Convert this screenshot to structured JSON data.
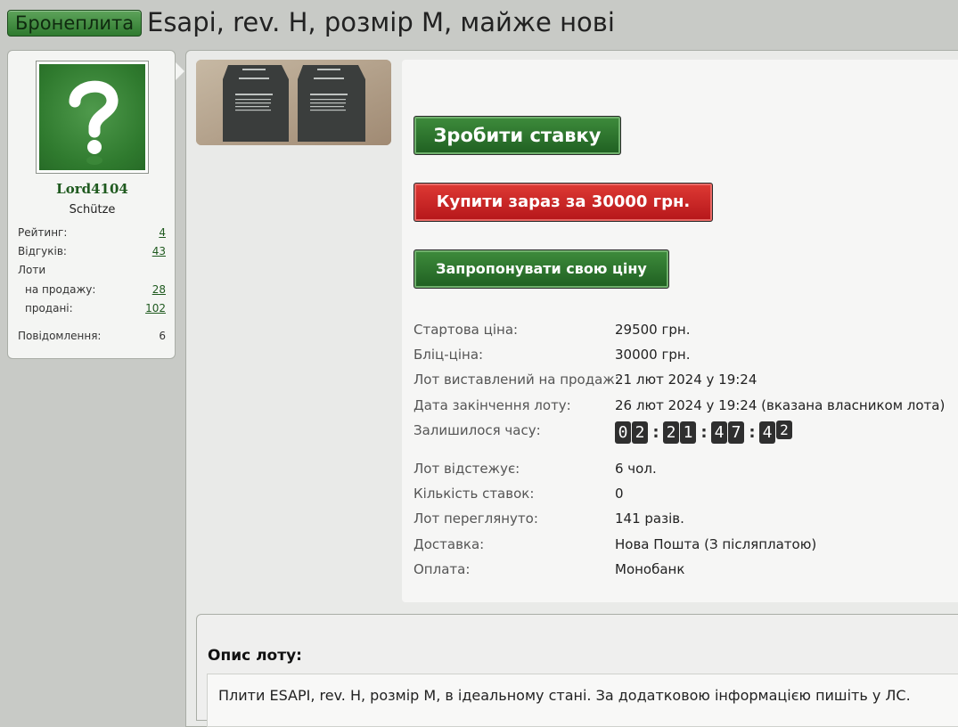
{
  "header": {
    "category_label": "Бронеплита",
    "title": "Esapi, rev. H, розмір M, майже нові"
  },
  "seller": {
    "username": "Lord4104",
    "rank": "Schütze",
    "stats": {
      "rating_label": "Рейтинг:",
      "rating_value": "4",
      "reviews_label": "Відгуків:",
      "reviews_value": "43",
      "lots_label": "Лоти",
      "on_sale_label": "на продажу:",
      "on_sale_value": "28",
      "sold_label": "продані:",
      "sold_value": "102",
      "messages_label": "Повідомлення:",
      "messages_value": "6"
    }
  },
  "actions": {
    "bid_label": "Зробити ставку",
    "buy_now_label": "Купити зараз за 30000 грн.",
    "offer_label": "Запропонувати свою ціну"
  },
  "details": {
    "start_price_label": "Стартова ціна:",
    "start_price_value": "29500 грн.",
    "blitz_price_label": "Бліц-ціна:",
    "blitz_price_value": "30000 грн.",
    "listed_label": "Лот виставлений на продаж:",
    "listed_value": "21 лют 2024 у 19:24",
    "end_label": "Дата закінчення лоту:",
    "end_value": "26 лют 2024 у 19:24 (вказана власником лота)",
    "remaining_label": "Залишилося часу:",
    "remaining_digits": [
      "0",
      "2",
      "2",
      "1",
      "4",
      "7",
      "4",
      "2"
    ],
    "remaining_separator": ":",
    "watchers_label": "Лот відстежує:",
    "watchers_value": "6 чол.",
    "bids_label": "Кількість ставок:",
    "bids_value": "0",
    "views_label": "Лот переглянуто:",
    "views_value": "141 разів.",
    "delivery_label": "Доставка:",
    "delivery_value": "Нова Пошта (З післяплатою)",
    "payment_label": "Оплата:",
    "payment_value": "Монобанк"
  },
  "thumbnail": {
    "plate_label_top": "STRIKE FACE"
  },
  "description": {
    "heading": "Опис лоту:",
    "text": "Плити ESAPI, rev. H, розмір M, в ідеальному стані. За додатковою інформацією пишіть у ЛС."
  },
  "colors": {
    "accent_green": "#2f7a2f",
    "buy_red": "#c8201f",
    "background": "#c8cac6"
  }
}
